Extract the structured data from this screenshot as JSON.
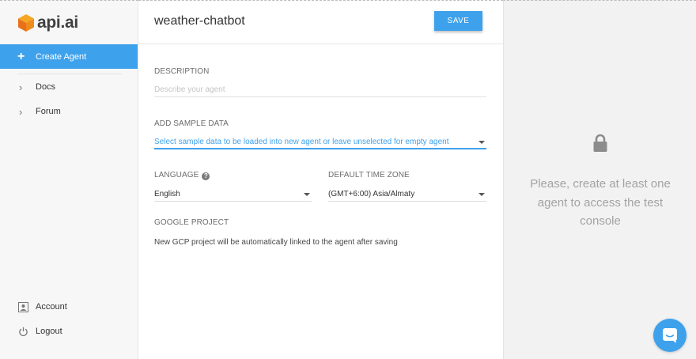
{
  "brand": {
    "logo_text": "api.ai",
    "accent": "#3ea1ec"
  },
  "sidebar": {
    "create_agent": "Create Agent",
    "items": [
      {
        "label": "Docs",
        "icon": "chevron-right-icon"
      },
      {
        "label": "Forum",
        "icon": "chevron-right-icon"
      }
    ],
    "bottom_items": [
      {
        "label": "Account",
        "icon": "account-icon"
      },
      {
        "label": "Logout",
        "icon": "power-icon"
      }
    ]
  },
  "header": {
    "agent_name": "weather-chatbot",
    "save_label": "SAVE"
  },
  "form": {
    "description": {
      "label": "DESCRIPTION",
      "placeholder": "Describe your agent"
    },
    "sample_data": {
      "label": "ADD SAMPLE DATA",
      "value": "Select sample data to be loaded into new agent or leave unselected for empty agent"
    },
    "language": {
      "label": "LANGUAGE",
      "value": "English",
      "help_icon": "?"
    },
    "timezone": {
      "label": "DEFAULT TIME ZONE",
      "value": "(GMT+6:00) Asia/Almaty"
    },
    "google_project": {
      "label": "GOOGLE PROJECT",
      "text": "New GCP project will be automatically linked to the agent after saving"
    }
  },
  "console": {
    "message": "Please, create at least one agent to access the test console",
    "icon": "lock-icon"
  },
  "chat": {
    "icon": "chat-icon"
  }
}
